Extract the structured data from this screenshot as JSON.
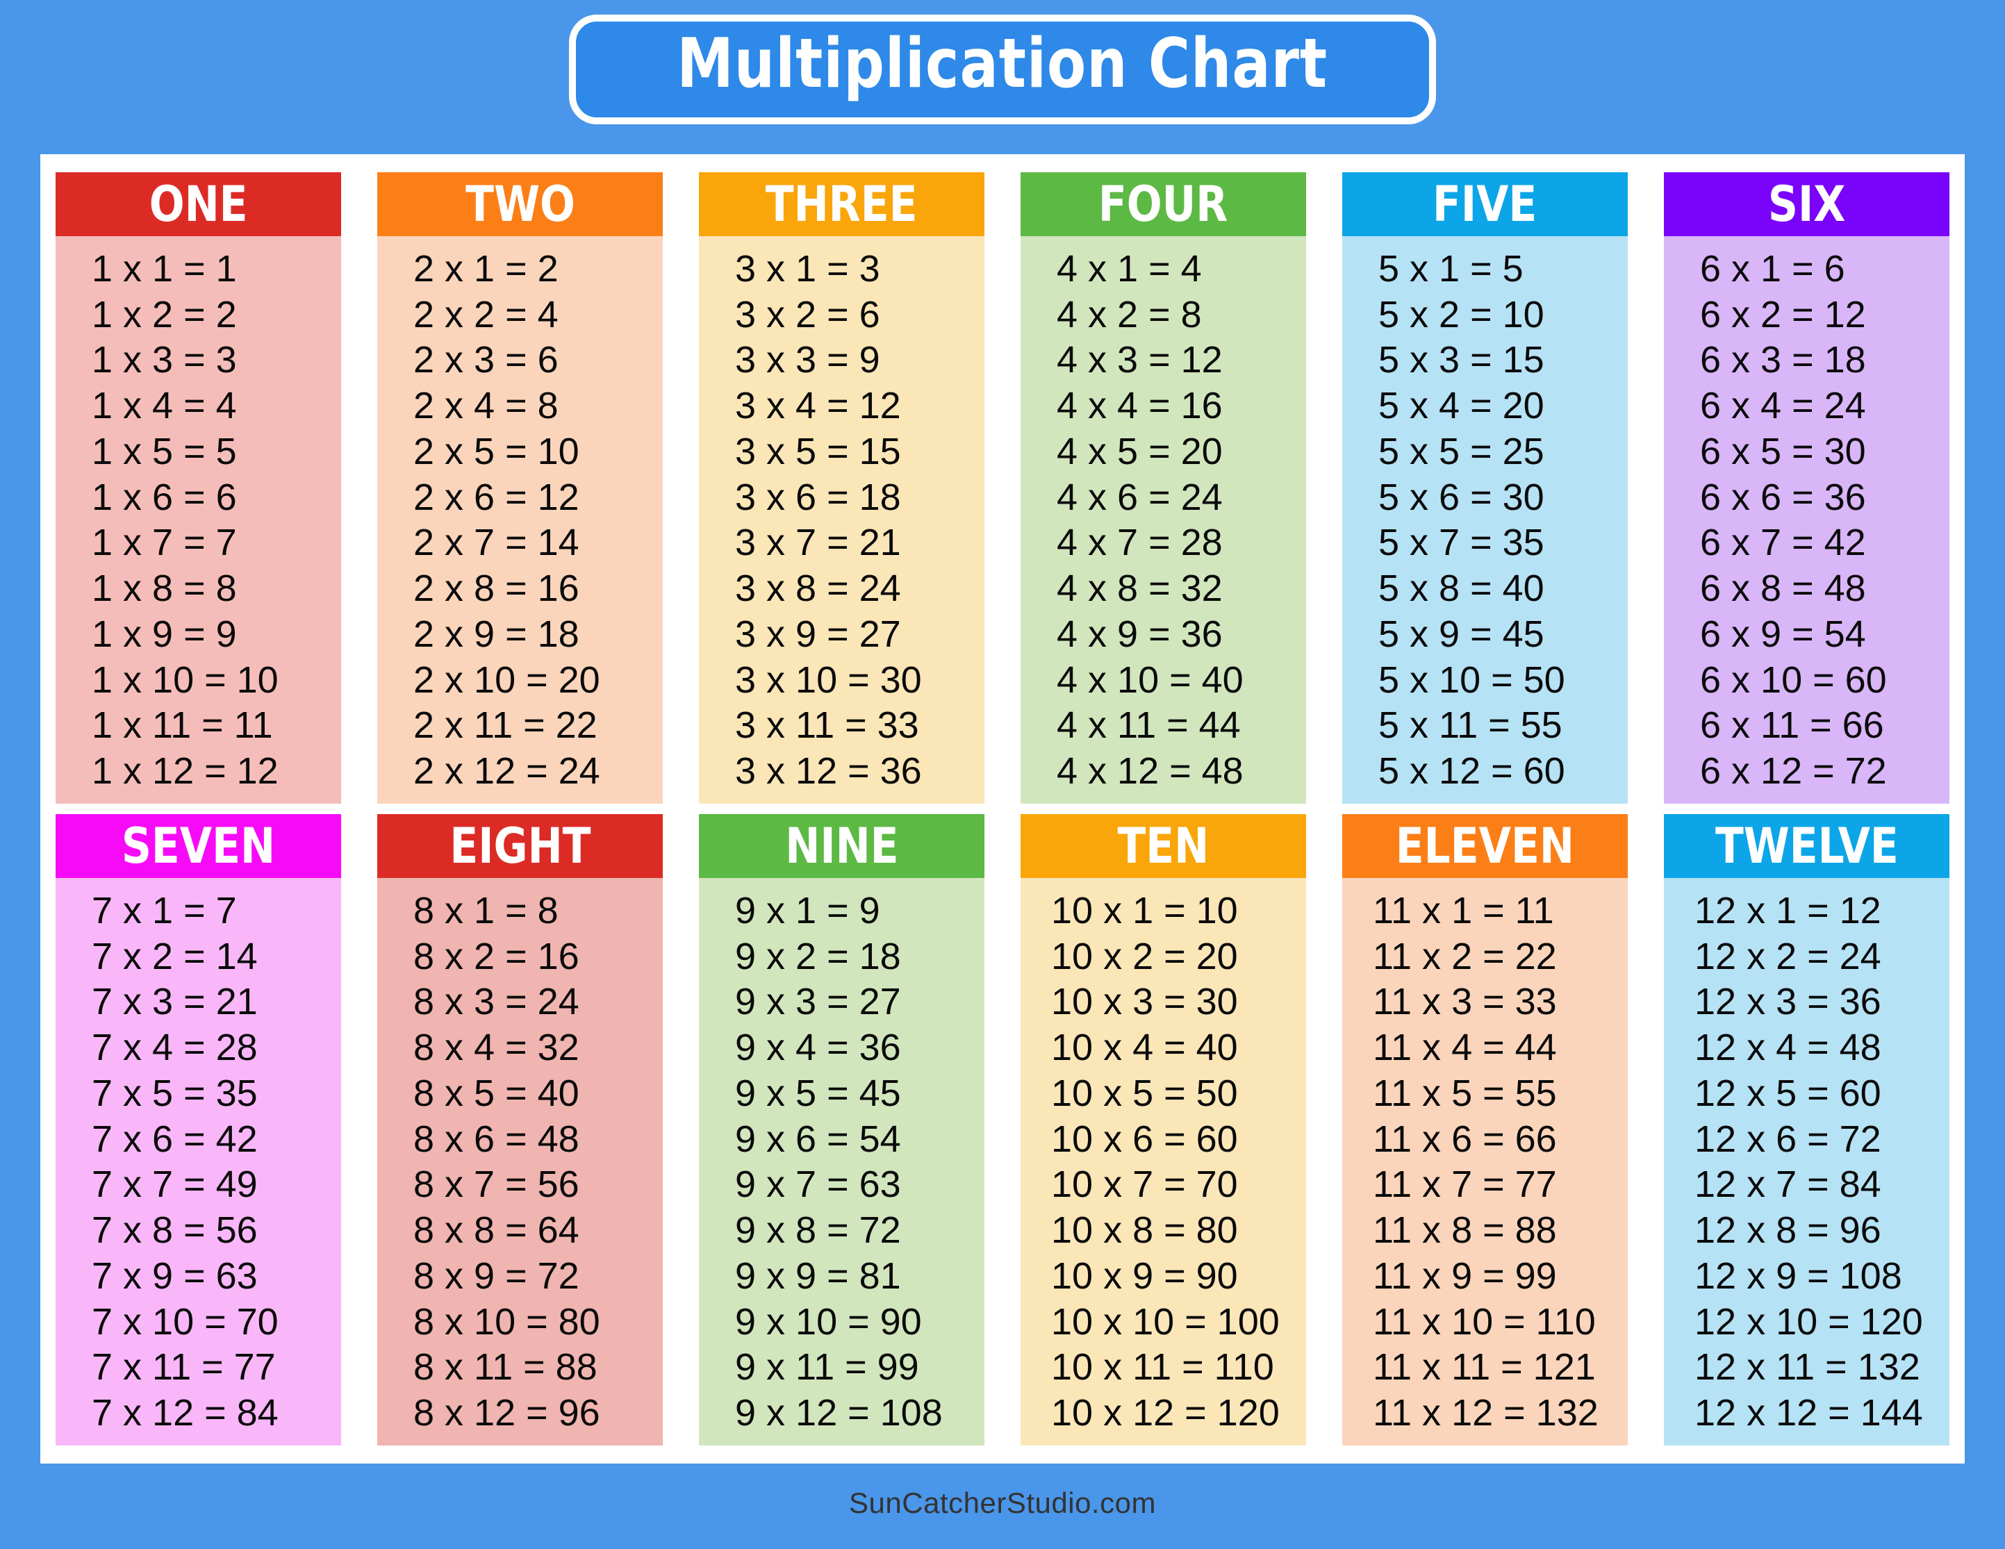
{
  "title": "Multiplication Chart",
  "footer": "SunCatcherStudio.com",
  "palette": {
    "page_background": "#4A96EA",
    "panel_background": "#FFFFFF",
    "title_box": "#2E89E8",
    "title_border": "#FFFFFF",
    "title_text": "#FFFFFF",
    "cell_text": "#0A0A0A",
    "footer_text": "#333333"
  },
  "chart_data": {
    "type": "table",
    "title": "Multiplication Chart",
    "description": "Times tables from 1 through 12, each column listing twelve products.",
    "multiplicand_range": [
      1,
      12
    ],
    "multiplier_range": [
      1,
      12
    ],
    "columns": [
      {
        "name": "ONE",
        "factor": 1,
        "header_color": "#DC2B25",
        "body_color": "#F5BDB9",
        "rows": [
          "1 x 1 = 1",
          "1 x 2 = 2",
          "1 x 3 = 3",
          "1 x 4 = 4",
          "1 x 5 = 5",
          "1 x 6 = 6",
          "1 x 7 = 7",
          "1 x 8 = 8",
          "1 x 9 = 9",
          "1 x 10 = 10",
          "1 x 11 = 11",
          "1 x 12 = 12"
        ],
        "products": [
          1,
          2,
          3,
          4,
          5,
          6,
          7,
          8,
          9,
          10,
          11,
          12
        ]
      },
      {
        "name": "TWO",
        "factor": 2,
        "header_color": "#FC7E17",
        "body_color": "#FBD5BB",
        "rows": [
          "2 x 1 = 2",
          "2 x 2 = 4",
          "2 x 3 = 6",
          "2 x 4 = 8",
          "2 x 5 = 10",
          "2 x 6 = 12",
          "2 x 7 = 14",
          "2 x 8 = 16",
          "2 x 9 = 18",
          "2 x 10 = 20",
          "2 x 11 = 22",
          "2 x 12 = 24"
        ],
        "products": [
          2,
          4,
          6,
          8,
          10,
          12,
          14,
          16,
          18,
          20,
          22,
          24
        ]
      },
      {
        "name": "THREE",
        "factor": 3,
        "header_color": "#FAA50A",
        "body_color": "#FBE6B8",
        "rows": [
          "3 x 1 = 3",
          "3 x 2 = 6",
          "3 x 3 = 9",
          "3 x 4 = 12",
          "3 x 5 = 15",
          "3 x 6 = 18",
          "3 x 7 = 21",
          "3 x 8 = 24",
          "3 x 9 = 27",
          "3 x 10 = 30",
          "3 x 11 = 33",
          "3 x 12 = 36"
        ],
        "products": [
          3,
          6,
          9,
          12,
          15,
          18,
          21,
          24,
          27,
          30,
          33,
          36
        ]
      },
      {
        "name": "FOUR",
        "factor": 4,
        "header_color": "#5CB944",
        "body_color": "#D2E6BE",
        "rows": [
          "4 x 1 = 4",
          "4 x 2 = 8",
          "4 x 3 = 12",
          "4 x 4 = 16",
          "4 x 5 = 20",
          "4 x 6 = 24",
          "4 x 7 = 28",
          "4 x 8 = 32",
          "4 x 9 = 36",
          "4 x 10 = 40",
          "4 x 11 = 44",
          "4 x 12 = 48"
        ],
        "products": [
          4,
          8,
          12,
          16,
          20,
          24,
          28,
          32,
          36,
          40,
          44,
          48
        ]
      },
      {
        "name": "FIVE",
        "factor": 5,
        "header_color": "#0CA5E8",
        "body_color": "#B6E2F5",
        "rows": [
          "5 x 1 = 5",
          "5 x 2 = 10",
          "5 x 3 = 15",
          "5 x 4 = 20",
          "5 x 5 = 25",
          "5 x 6 = 30",
          "5 x 7 = 35",
          "5 x 8 = 40",
          "5 x 9 = 45",
          "5 x 10 = 50",
          "5 x 11 = 55",
          "5 x 12 = 60"
        ],
        "products": [
          5,
          10,
          15,
          20,
          25,
          30,
          35,
          40,
          45,
          50,
          55,
          60
        ]
      },
      {
        "name": "SIX",
        "factor": 6,
        "header_color": "#7A03FB",
        "body_color": "#D9B6F8",
        "rows": [
          "6 x 1 = 6",
          "6 x 2 = 12",
          "6 x 3 = 18",
          "6 x 4 = 24",
          "6 x 5 = 30",
          "6 x 6 = 36",
          "6 x 7 = 42",
          "6 x 8 = 48",
          "6 x 9 = 54",
          "6 x 10 = 60",
          "6 x 11 = 66",
          "6 x 12 = 72"
        ],
        "products": [
          6,
          12,
          18,
          24,
          30,
          36,
          42,
          48,
          54,
          60,
          66,
          72
        ]
      },
      {
        "name": "SEVEN",
        "factor": 7,
        "header_color": "#F70BF7",
        "body_color": "#F9B7F9",
        "rows": [
          "7 x 1 = 7",
          "7 x 2 = 14",
          "7 x 3 = 21",
          "7 x 4 = 28",
          "7 x 5 = 35",
          "7 x 6 = 42",
          "7 x 7 = 49",
          "7 x 8 = 56",
          "7 x 9 = 63",
          "7 x 10 = 70",
          "7 x 11 = 77",
          "7 x 12 = 84"
        ],
        "products": [
          7,
          14,
          21,
          28,
          35,
          42,
          49,
          56,
          63,
          70,
          77,
          84
        ]
      },
      {
        "name": "EIGHT",
        "factor": 8,
        "header_color": "#DC2B25",
        "body_color": "#F0B5B0",
        "rows": [
          "8 x 1 = 8",
          "8 x 2 = 16",
          "8 x 3 = 24",
          "8 x 4 = 32",
          "8 x 5 = 40",
          "8 x 6 = 48",
          "8 x 7 = 56",
          "8 x 8 = 64",
          "8 x 9 = 72",
          "8 x 10 = 80",
          "8 x 11 = 88",
          "8 x 12 = 96"
        ],
        "products": [
          8,
          16,
          24,
          32,
          40,
          48,
          56,
          64,
          72,
          80,
          88,
          96
        ]
      },
      {
        "name": "NINE",
        "factor": 9,
        "header_color": "#5CB944",
        "body_color": "#D2E6BE",
        "rows": [
          "9 x 1 = 9",
          "9 x 2 = 18",
          "9 x 3 = 27",
          "9 x 4 = 36",
          "9 x 5 = 45",
          "9 x 6 = 54",
          "9 x 7 = 63",
          "9 x 8 = 72",
          "9 x 9 = 81",
          "9 x 10 = 90",
          "9 x 11 = 99",
          "9 x 12 = 108"
        ],
        "products": [
          9,
          18,
          27,
          36,
          45,
          54,
          63,
          72,
          81,
          90,
          99,
          108
        ]
      },
      {
        "name": "TEN",
        "factor": 10,
        "header_color": "#FAA50A",
        "body_color": "#FBE6B8",
        "rows": [
          "10 x 1 = 10",
          "10 x 2 = 20",
          "10 x 3 = 30",
          "10 x 4 = 40",
          "10 x 5 = 50",
          "10 x 6 = 60",
          "10 x 7 = 70",
          "10 x 8 = 80",
          "10 x 9 = 90",
          "10 x 10 = 100",
          "10 x 11 = 110",
          "10 x 12 = 120"
        ],
        "products": [
          10,
          20,
          30,
          40,
          50,
          60,
          70,
          80,
          90,
          100,
          110,
          120
        ]
      },
      {
        "name": "ELEVEN",
        "factor": 11,
        "header_color": "#FC7E17",
        "body_color": "#FBD5BB",
        "rows": [
          "11 x 1 = 11",
          "11 x 2 = 22",
          "11 x 3 = 33",
          "11 x 4 = 44",
          "11 x 5 = 55",
          "11 x 6 = 66",
          "11 x 7 = 77",
          "11 x 8 = 88",
          "11 x 9 = 99",
          "11 x 10 = 110",
          "11 x 11 = 121",
          "11 x 12 = 132"
        ],
        "products": [
          11,
          22,
          33,
          44,
          55,
          66,
          77,
          88,
          99,
          110,
          121,
          132
        ]
      },
      {
        "name": "TWELVE",
        "factor": 12,
        "header_color": "#0CA5E8",
        "body_color": "#B6E2F5",
        "rows": [
          "12 x 1 = 12",
          "12 x 2 = 24",
          "12 x 3 = 36",
          "12 x 4 = 48",
          "12 x 5 = 60",
          "12 x 6 = 72",
          "12 x 7 = 84",
          "12 x 8 = 96",
          "12 x 9 = 108",
          "12 x 10 = 120",
          "12 x 11 = 132",
          "12 x 12 = 144"
        ],
        "products": [
          12,
          24,
          36,
          48,
          60,
          72,
          84,
          96,
          108,
          120,
          132,
          144
        ]
      }
    ]
  }
}
